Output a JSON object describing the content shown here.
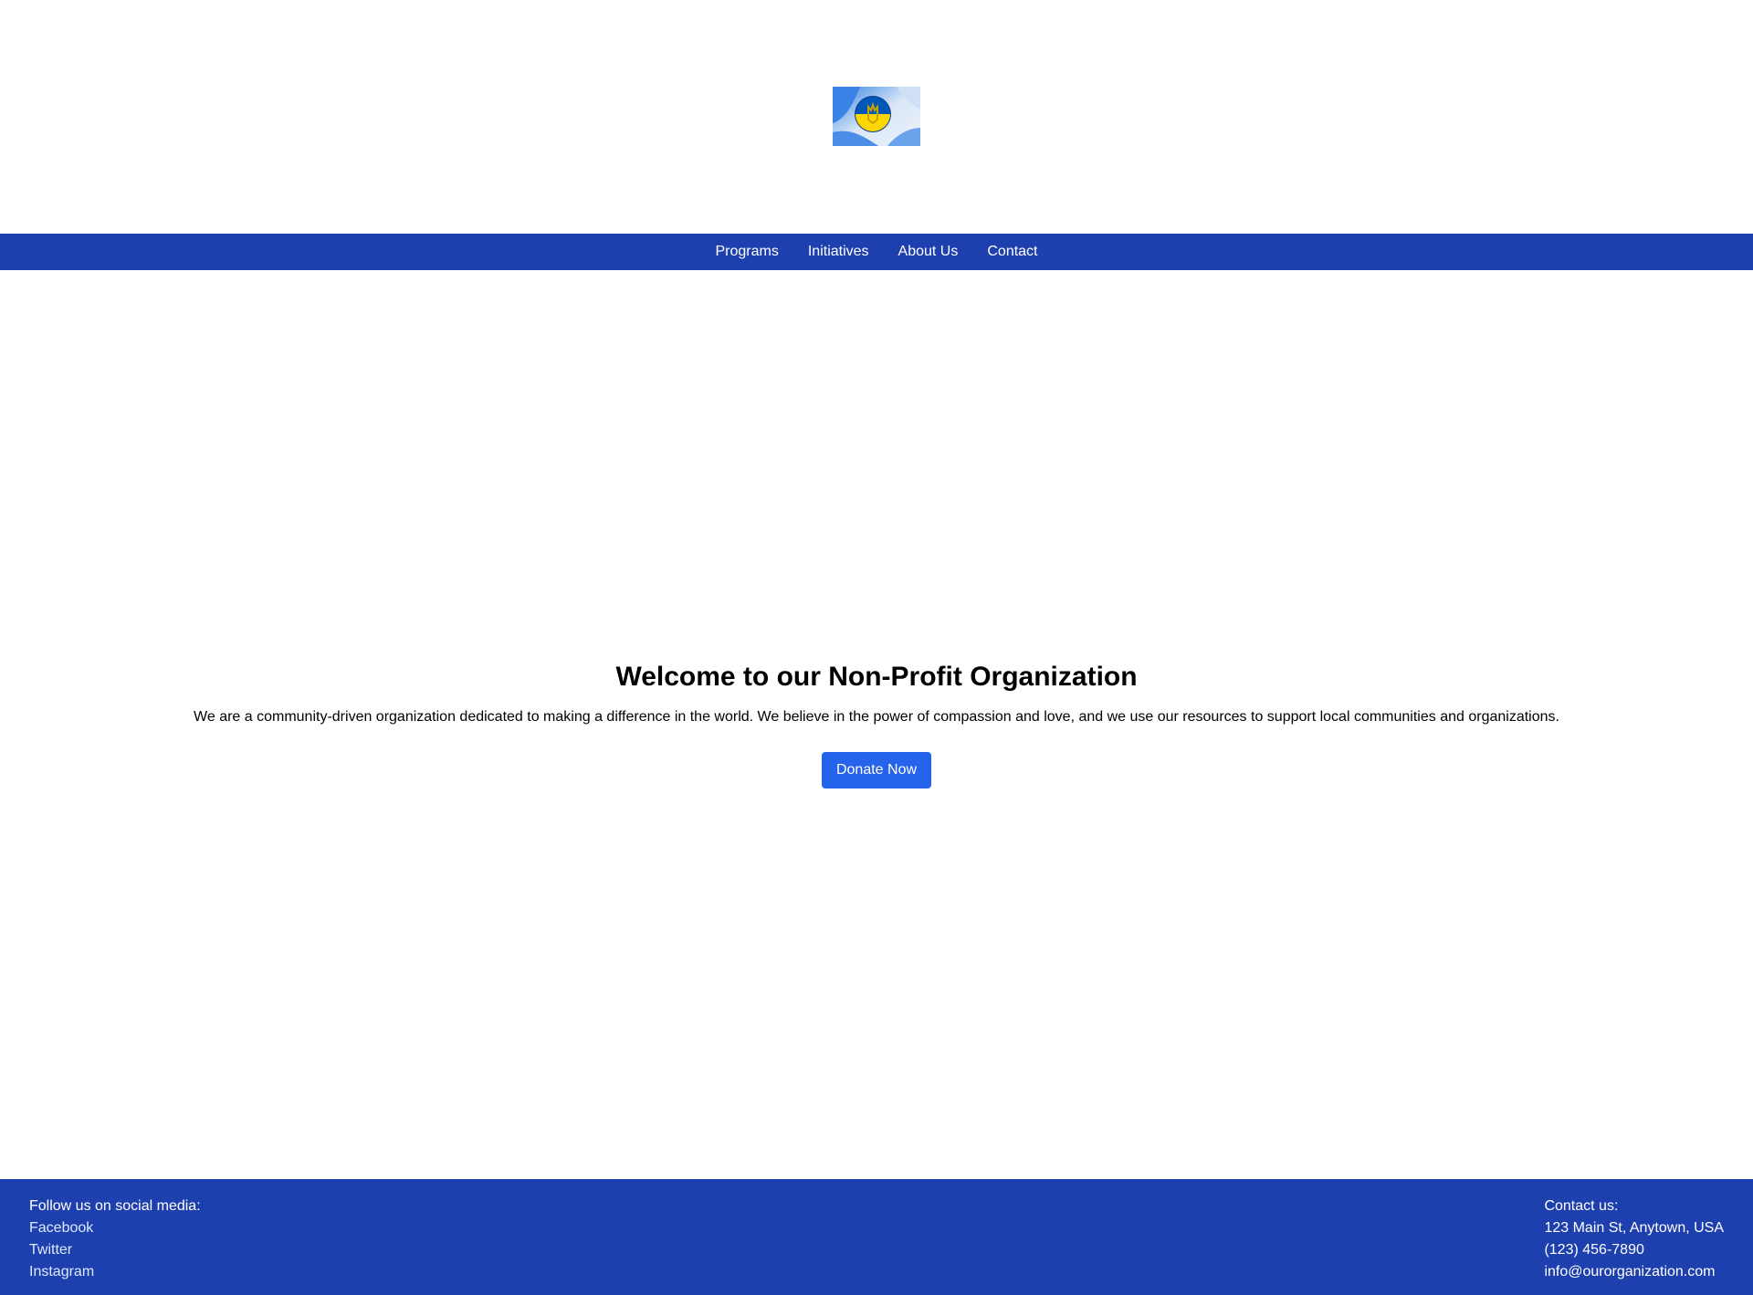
{
  "nav": {
    "items": [
      "Programs",
      "Initiatives",
      "About Us",
      "Contact"
    ]
  },
  "hero": {
    "title": "Welcome to our Non-Profit Organization",
    "text": "We are a community-driven organization dedicated to making a difference in the world. We believe in the power of compassion and love, and we use our resources to support local communities and organizations.",
    "button_label": "Donate Now"
  },
  "footer": {
    "social_heading": "Follow us on social media:",
    "social_links": [
      "Facebook",
      "Twitter",
      "Instagram"
    ],
    "contact_heading": "Contact us:",
    "address": "123 Main St, Anytown, USA",
    "phone": "(123) 456-7890",
    "email": "info@ourorganization.com"
  },
  "colors": {
    "brand_blue": "#1e40af",
    "button_blue": "#2563eb",
    "flag_blue": "#0057b7",
    "flag_yellow": "#ffd700"
  },
  "icons": {
    "logo": "ukraine-emblem-logo"
  }
}
